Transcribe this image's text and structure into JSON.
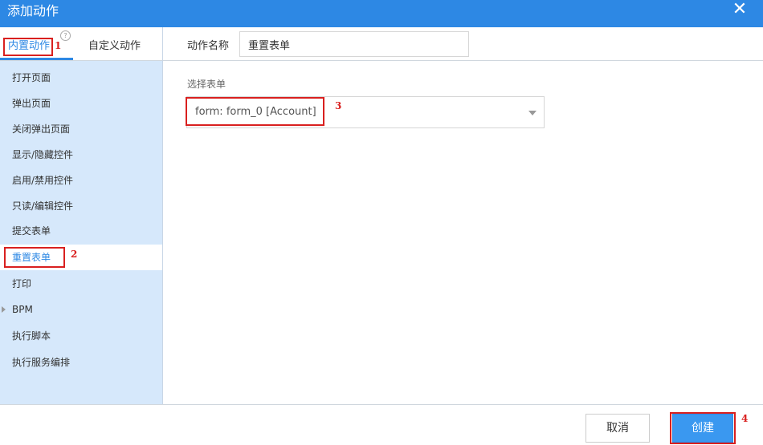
{
  "dialog": {
    "title": "添加动作",
    "close_icon": "close-icon"
  },
  "sidebar": {
    "tabs": [
      {
        "label": "内置动作",
        "active": true
      },
      {
        "label": "自定义动作",
        "active": false
      }
    ],
    "help_glyph": "?",
    "items": [
      {
        "label": "打开页面"
      },
      {
        "label": "弹出页面"
      },
      {
        "label": "关闭弹出页面"
      },
      {
        "label": "显示/隐藏控件"
      },
      {
        "label": "启用/禁用控件"
      },
      {
        "label": "只读/编辑控件"
      },
      {
        "label": "提交表单"
      },
      {
        "label": "重置表单",
        "selected": true
      },
      {
        "label": "打印"
      },
      {
        "label": "BPM",
        "expandable": true
      },
      {
        "label": "执行脚本"
      },
      {
        "label": "执行服务编排"
      }
    ]
  },
  "main": {
    "action_name_label": "动作名称",
    "action_name_value": "重置表单",
    "select_form_label": "选择表单",
    "select_form_value": "form: form_0 [Account]"
  },
  "footer": {
    "cancel_label": "取消",
    "create_label": "创建"
  },
  "annotations": [
    "1",
    "2",
    "3",
    "4"
  ],
  "colors": {
    "accent": "#2d88e4",
    "sidebar_bg": "#d6e8fb",
    "annotation": "#d9201f"
  }
}
